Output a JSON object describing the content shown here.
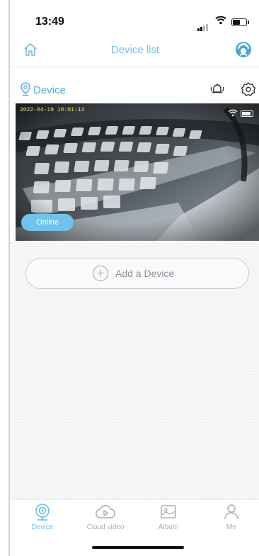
{
  "status_bar": {
    "time": "13:49"
  },
  "nav": {
    "title": "Device list",
    "home_icon": "home-icon",
    "avatar_icon": "user-avatar-icon"
  },
  "device": {
    "name": "Device",
    "location_icon": "location-pin-icon",
    "alarm_icon": "alarm-bell-icon",
    "settings_icon": "gear-icon",
    "timestamp": "2022-04-19 10:01:13",
    "status": "Online"
  },
  "add_device": {
    "label": "Add a Device"
  },
  "tabs": [
    {
      "label": "Device",
      "icon": "device-camera-icon",
      "active": true
    },
    {
      "label": "Cloud video",
      "icon": "cloud-play-icon",
      "active": false
    },
    {
      "label": "Album",
      "icon": "album-image-icon",
      "active": false
    },
    {
      "label": "Me",
      "icon": "person-icon",
      "active": false
    }
  ],
  "colors": {
    "accent": "#6cbde4",
    "accent_dark": "#53aedd",
    "inactive": "#a8adb2"
  }
}
